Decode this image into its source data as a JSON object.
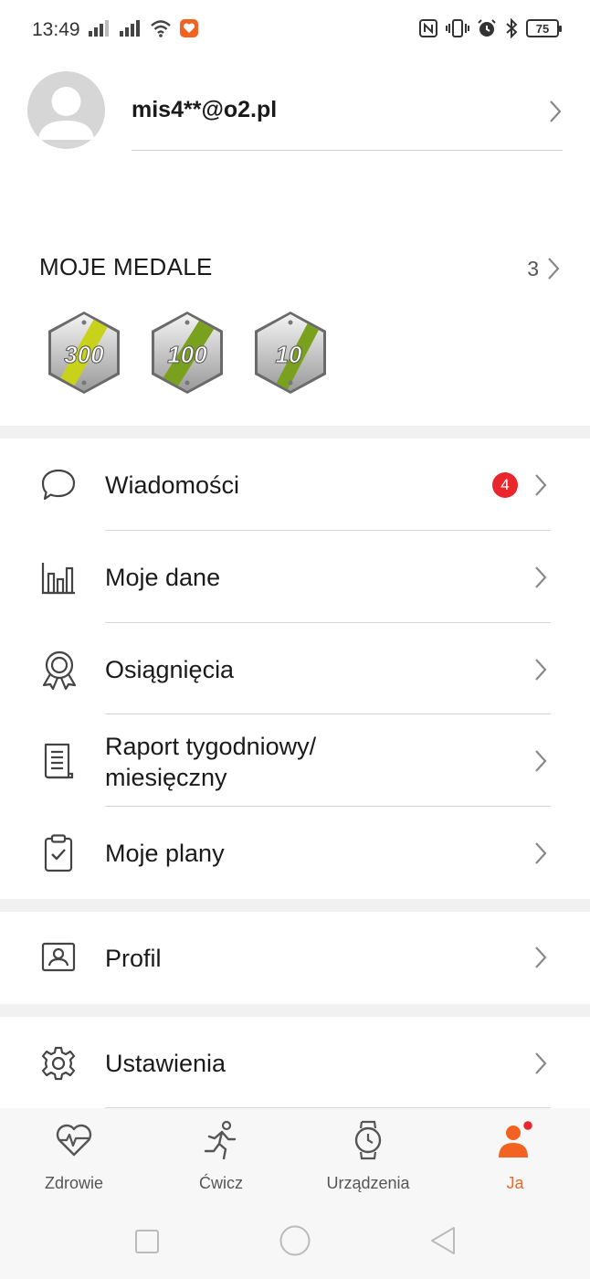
{
  "status_bar": {
    "time": "13:49",
    "battery": "75"
  },
  "profile": {
    "username": "mis4**@o2.pl"
  },
  "medals": {
    "title": "MOJE MEDALE",
    "count": "3",
    "items": [
      {
        "value": "300",
        "stripe": "#c9d21a"
      },
      {
        "value": "100",
        "stripe": "#79a11d"
      },
      {
        "value": "10",
        "stripe": "#79a11d"
      }
    ]
  },
  "menu": {
    "messages": {
      "label": "Wiadomości",
      "badge": "4"
    },
    "my_data": {
      "label": "Moje dane"
    },
    "achievements": {
      "label": "Osiągnięcia"
    },
    "report_line1": "Raport tygodniowy/",
    "report_line2": "miesięczny",
    "plans": {
      "label": "Moje plany"
    },
    "profile": {
      "label": "Profil"
    },
    "settings": {
      "label": "Ustawienia"
    }
  },
  "bottom_nav": {
    "health": "Zdrowie",
    "exercise": "Ćwicz",
    "devices": "Urządzenia",
    "me": "Ja"
  },
  "colors": {
    "accent": "#f26322",
    "badge": "#e8262c"
  }
}
